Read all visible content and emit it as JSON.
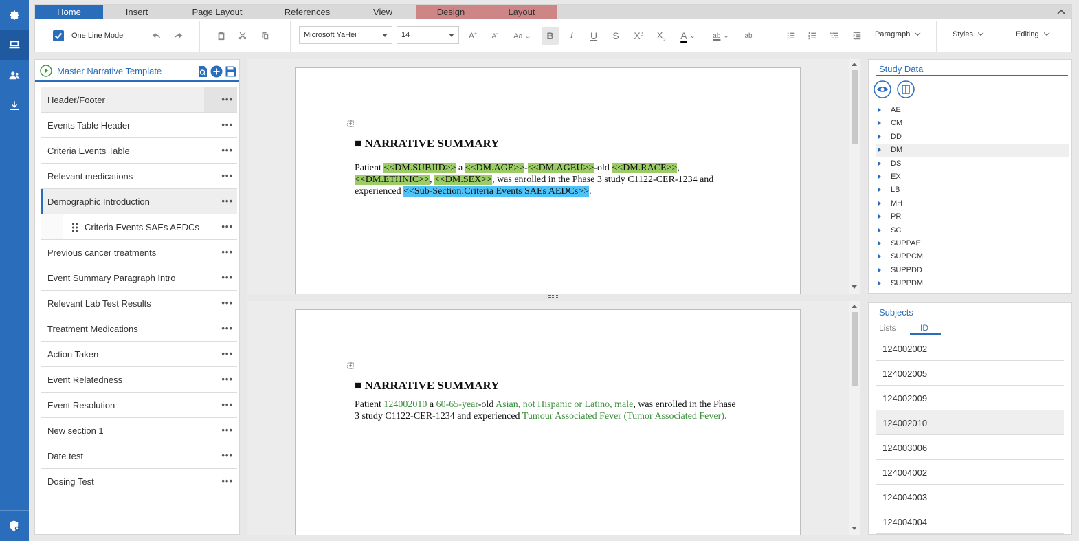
{
  "ribbon": {
    "tabs": [
      {
        "label": "Home"
      },
      {
        "label": "Insert"
      },
      {
        "label": "Page Layout"
      },
      {
        "label": "References"
      },
      {
        "label": "View"
      },
      {
        "label": "Design"
      },
      {
        "label": "Layout"
      }
    ],
    "one_line_mode": "One Line Mode",
    "font_family": "Microsoft YaHei",
    "font_size": "14",
    "paragraph": "Paragraph",
    "styles": "Styles",
    "editing": "Editing"
  },
  "left_panel": {
    "title": "Master Narrative Template",
    "sections": [
      {
        "label": "Header/Footer"
      },
      {
        "label": "Events Table Header"
      },
      {
        "label": "Criteria Events Table"
      },
      {
        "label": "Relevant medications"
      },
      {
        "label": "Demographic Introduction"
      },
      {
        "label": "Criteria Events SAEs AEDCs"
      },
      {
        "label": "Previous cancer treatments"
      },
      {
        "label": "Event Summary Paragraph Intro"
      },
      {
        "label": "Relevant Lab Test Results"
      },
      {
        "label": "Treatment Medications"
      },
      {
        "label": "Action Taken"
      },
      {
        "label": "Event Relatedness"
      },
      {
        "label": "Event Resolution"
      },
      {
        "label": "New section 1"
      },
      {
        "label": "Date test"
      },
      {
        "label": "Dosing Test"
      }
    ],
    "more": "•••"
  },
  "template_pane": {
    "heading": "■ NARRATIVE SUMMARY",
    "t1": "Patient ",
    "subjid": "<<DM.SUBJID>>",
    "t2": " a ",
    "age": "<<DM.AGE>>",
    "t3": "-",
    "ageu": "<<DM.AGEU>>",
    "t4": "-old ",
    "race": "<<DM.RACE>>",
    "t5": ",",
    "ethnic": "<<DM.ETHNIC>>",
    "t6": ", ",
    "sex": "<<DM.SEX>>",
    "t7": ", was enrolled in the Phase 3 study C1122-CER-1234 and experienced ",
    "subsection": "<<Sub-Section:Criteria Events SAEs AEDCs>>",
    "t8": "."
  },
  "preview_pane": {
    "heading": "■ NARRATIVE SUMMARY",
    "t1": "Patient ",
    "subjid": "124002010",
    "t2": " a ",
    "age": "60-65",
    "t3": "-",
    "ageu": "year",
    "t4": "-old ",
    "race": "Asian",
    "t5": ", ",
    "ethnic": "not Hispanic or Latino",
    "t6": ", ",
    "sex": "male",
    "t7": ", was enrolled in the Phase 3 study C1122-CER-1234 and experienced ",
    "event": "Tumour Associated Fever (Tumor Associated Fever)",
    "t8": "."
  },
  "study_data": {
    "title": "Study Data",
    "domains": [
      "AE",
      "CM",
      "DD",
      "DM",
      "DS",
      "EX",
      "LB",
      "MH",
      "PR",
      "SC",
      "SUPPAE",
      "SUPPCM",
      "SUPPDD",
      "SUPPDM"
    ]
  },
  "subjects": {
    "title": "Subjects",
    "tabs": [
      "Lists",
      "ID"
    ],
    "ids": [
      "124002002",
      "124002005",
      "124002009",
      "124002010",
      "124003006",
      "124004002",
      "124004003",
      "124004004"
    ]
  }
}
